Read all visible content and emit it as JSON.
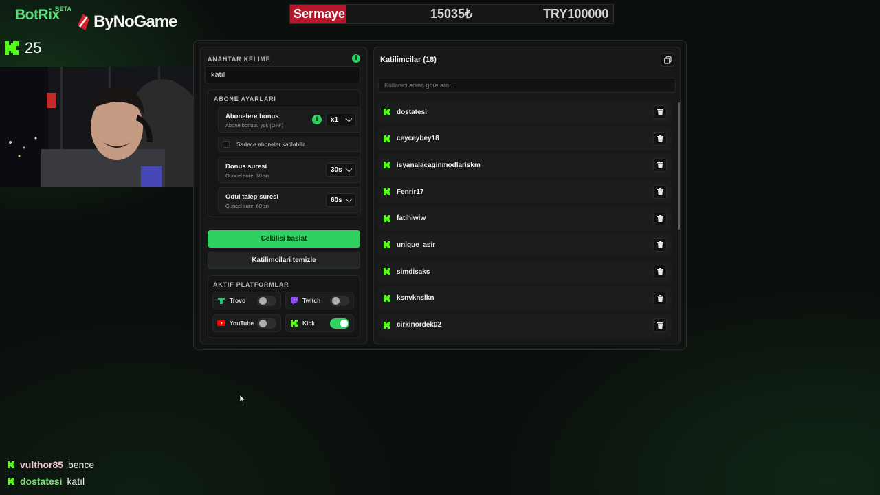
{
  "branding": {
    "botrix": "BotRix",
    "beta": "BETA",
    "bynogame": "ByNoGame"
  },
  "ticker": {
    "label": "Sermaye",
    "value": "15035₺",
    "target": "TRY100000"
  },
  "viewers": {
    "count": "25",
    "icon": "kick-icon"
  },
  "keyword": {
    "title": "ANAHTAR KELIME",
    "value": "katıl"
  },
  "subscriber": {
    "title": "ABONE AYARLARI",
    "bonus_label": "Abonelere bonus",
    "bonus_sub": "Abone bonusu yok (OFF)",
    "bonus_value": "x1",
    "only_subs_label": "Sadece aboneler katilabilir",
    "duration_label": "Donus suresi",
    "duration_sub": "Guncel sure: 30 sn",
    "duration_value": "30s",
    "claim_label": "Odul talep suresi",
    "claim_sub": "Guncel sure: 60 sn",
    "claim_value": "60s"
  },
  "actions": {
    "start": "Cekilisi baslat",
    "clear": "Katilimcilari temizle"
  },
  "platforms": {
    "title": "AKTIF PLATFORMLAR",
    "items": [
      {
        "name": "Trovo",
        "enabled": false,
        "color": "#1fc66c"
      },
      {
        "name": "Twitch",
        "enabled": false,
        "color": "#9146ff"
      },
      {
        "name": "YouTube",
        "enabled": false,
        "color": "#ff0000"
      },
      {
        "name": "Kick",
        "enabled": true,
        "color": "#53fc18"
      }
    ]
  },
  "participants": {
    "title": "Katilimcilar (18)",
    "search_placeholder": "Kullanici adina gore ara...",
    "list": [
      "dostatesi",
      "ceyceybey18",
      "isyanalacaginmodlariskm",
      "Fenrir17",
      "fatihiwiw",
      "unique_asir",
      "simdisaks",
      "ksnvknslkn",
      "cirkinordek02"
    ]
  },
  "chat": [
    {
      "user": "vulthor85",
      "message": "bence",
      "user_color": "#f2c4d0"
    },
    {
      "user": "dostatesi",
      "message": "katıl",
      "user_color": "#7fe07a"
    }
  ],
  "colors": {
    "accent": "#2fd160",
    "kick": "#53fc18",
    "ticker_label_bg": "#b5182a"
  }
}
